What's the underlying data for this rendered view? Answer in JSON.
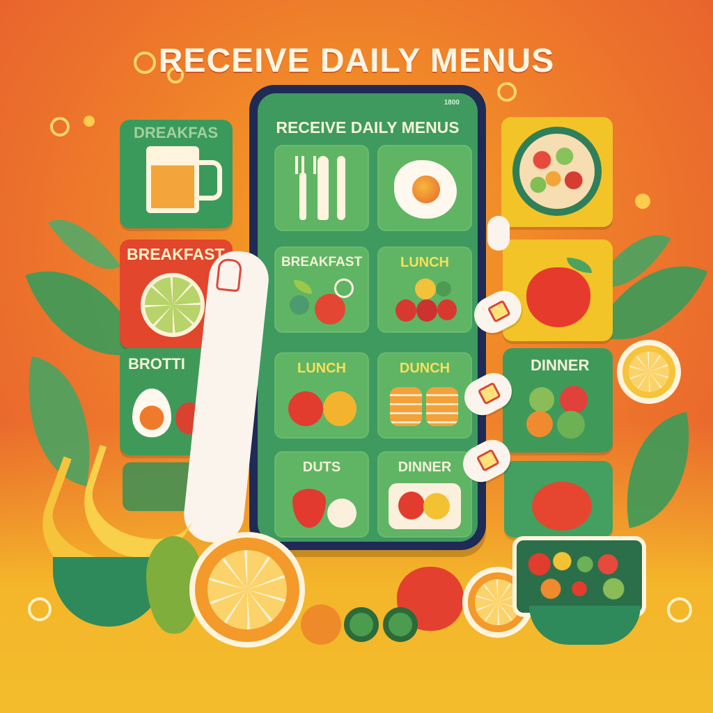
{
  "headline": "RECEIVE DAILY MENUS",
  "phone": {
    "status_text": "1800",
    "screen_title": "RECEIVE DAILY MENUS",
    "cards": [
      {
        "label": "",
        "icon": "fork-knife-icon"
      },
      {
        "label": "",
        "icon": "fried-egg-icon"
      },
      {
        "label": "BREAKFAST",
        "icon": "salad-icon"
      },
      {
        "label": "LUNCH",
        "icon": "cherries-icon"
      },
      {
        "label": "LUNCH",
        "icon": "tomato-icon"
      },
      {
        "label": "DUNCH",
        "icon": "bread-icon"
      },
      {
        "label": "DUTS",
        "icon": "strawberry-icon"
      },
      {
        "label": "DINNER",
        "icon": "plate-icon"
      }
    ]
  },
  "left_tiles": [
    {
      "label": "DREAKFAS",
      "icon": "juice-mug-icon"
    },
    {
      "label": "BREAKFAST",
      "icon": "lime-icon"
    },
    {
      "label": "BROTTI",
      "icon": "egg-icon"
    }
  ],
  "right_tiles": [
    {
      "label": "",
      "icon": "fruit-bowl-icon"
    },
    {
      "label": "",
      "icon": "apple-icon"
    },
    {
      "label": "DINNER",
      "icon": "mixed-fruit-icon"
    },
    {
      "label": "",
      "icon": "tomato-icon"
    }
  ],
  "colors": {
    "background_top": "#e4502f",
    "background_bottom": "#f2bd2c",
    "phone_frame": "#1f2a55",
    "screen_green": "#3e9a5e",
    "card_green": "#5fb564",
    "accent_red": "#d9463a"
  }
}
